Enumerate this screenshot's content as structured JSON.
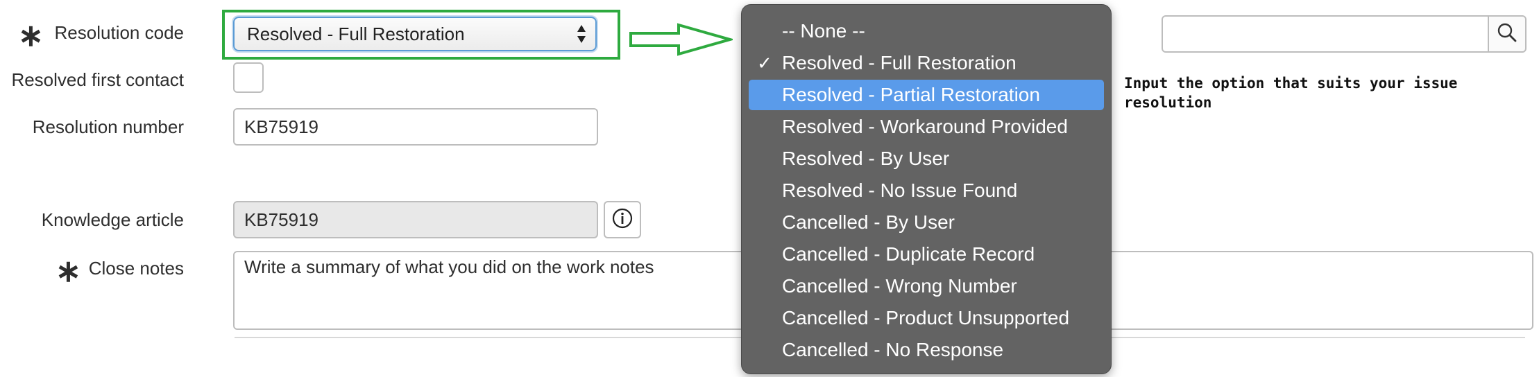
{
  "form": {
    "resolution_code_label": "Resolution code",
    "resolution_code_value": "Resolved - Full Restoration",
    "resolved_first_contact_label": "Resolved first contact",
    "resolution_number_label": "Resolution number",
    "resolution_number_value": "KB75919",
    "knowledge_article_label": "Knowledge article",
    "knowledge_article_value": "KB75919",
    "close_notes_label": "Close notes",
    "close_notes_value": "Write a summary of what you did on the work notes",
    "required_marker": "∗"
  },
  "dropdown": {
    "options": [
      {
        "label": "-- None --",
        "checked": false,
        "highlighted": false
      },
      {
        "label": "Resolved - Full Restoration",
        "checked": true,
        "highlighted": false
      },
      {
        "label": "Resolved - Partial Restoration",
        "checked": false,
        "highlighted": true
      },
      {
        "label": "Resolved - Workaround Provided",
        "checked": false,
        "highlighted": false
      },
      {
        "label": "Resolved - By User",
        "checked": false,
        "highlighted": false
      },
      {
        "label": "Resolved - No Issue Found",
        "checked": false,
        "highlighted": false
      },
      {
        "label": "Cancelled - By User",
        "checked": false,
        "highlighted": false
      },
      {
        "label": "Cancelled - Duplicate Record",
        "checked": false,
        "highlighted": false
      },
      {
        "label": "Cancelled - Wrong Number",
        "checked": false,
        "highlighted": false
      },
      {
        "label": "Cancelled - Product Unsupported",
        "checked": false,
        "highlighted": false
      },
      {
        "label": "Cancelled - No Response",
        "checked": false,
        "highlighted": false
      }
    ],
    "check_glyph": "✓"
  },
  "annotation": {
    "note": "Input the option that suits your issue resolution",
    "highlight_color": "#2eaa3f"
  },
  "colors": {
    "menu_bg": "#636363",
    "menu_selected": "#5a9bea",
    "select_border": "#5b9bd5"
  },
  "icons": {
    "search": "search-icon",
    "info": "info-icon",
    "select_arrows": "select-arrows-icon",
    "arrow": "arrow-right-icon"
  }
}
